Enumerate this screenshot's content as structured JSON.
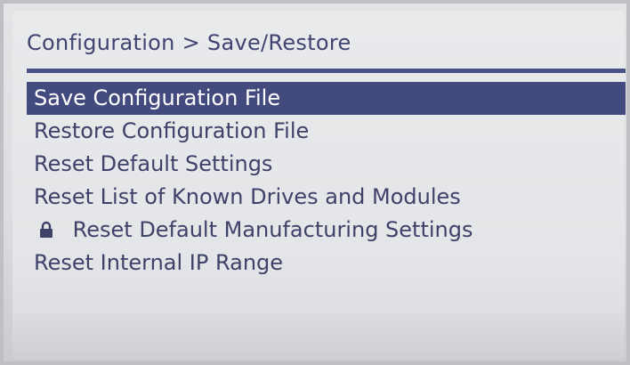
{
  "header": {
    "breadcrumb": "Configuration > Save/Restore"
  },
  "menu": {
    "items": [
      {
        "label": "Save Configuration File",
        "selected": true
      },
      {
        "label": "Restore Configuration File",
        "selected": false
      },
      {
        "label": "Reset Default Settings",
        "selected": false
      },
      {
        "label": "Reset List of Known Drives and Modules",
        "selected": false
      },
      {
        "label": "Reset Default Manufacturing Settings",
        "selected": false,
        "icon": "lock-icon"
      },
      {
        "label": "Reset Internal IP Range",
        "selected": false
      }
    ]
  },
  "colors": {
    "text": "#3e4269",
    "selection_background": "#434b7e",
    "selection_text": "#ffffff",
    "rule": "#4a5386",
    "screen_background": "#e6e7e9"
  }
}
